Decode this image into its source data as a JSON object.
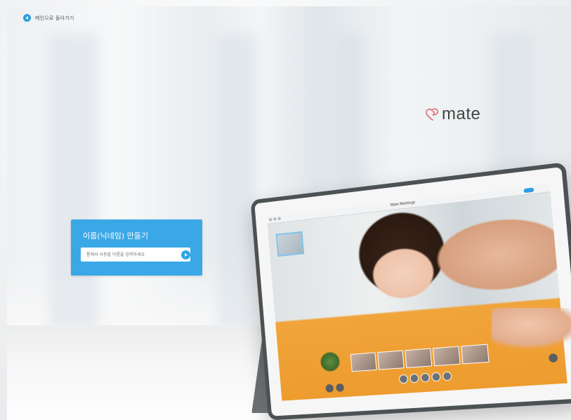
{
  "nav": {
    "back_label": "메인으로 돌아가기",
    "back_icon": "arrow-left-circle-icon"
  },
  "brand": {
    "logo_text": "mate",
    "logo_icon": "heart-outline-icon",
    "accent_color": "#e36b7a"
  },
  "name_panel": {
    "title": "이름(닉네임) 만들기",
    "input_value": "",
    "input_placeholder": "통에서 사용할 이름을 입력하세요",
    "submit_icon": "play-circle-icon",
    "panel_color": "#3aa8e6"
  },
  "tablet_screen": {
    "app_title": "Mate Meetings"
  }
}
